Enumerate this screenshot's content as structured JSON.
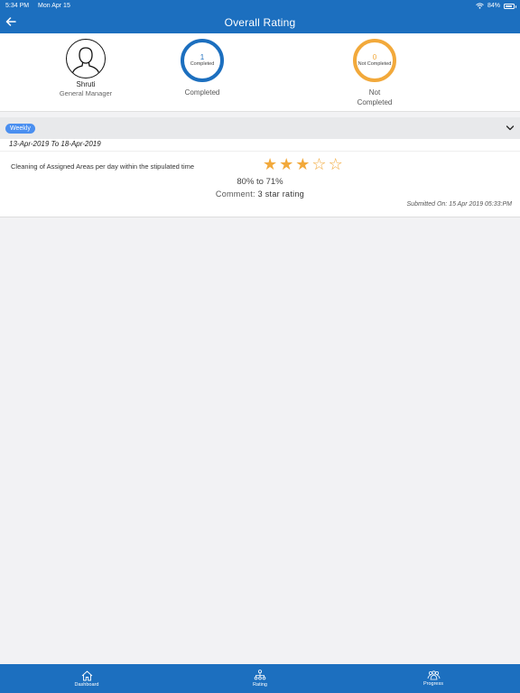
{
  "status_bar": {
    "time": "5:34 PM",
    "date": "Mon Apr 15",
    "battery": "84%",
    "battery_level": 0.84
  },
  "nav": {
    "title": "Overall Rating",
    "back_icon": "arrow-left-icon"
  },
  "profile": {
    "name": "Shruti",
    "role": "General Manager",
    "icon": "user-silhouette-icon"
  },
  "completed": {
    "count": "1",
    "inner_label": "Completed",
    "caption": "Completed",
    "color": "#1c6fbf"
  },
  "not_completed": {
    "count": "0",
    "inner_label": "Not Completed",
    "caption_line1": "Not",
    "caption_line2": "Completed",
    "color": "#f2a93b"
  },
  "rating_card": {
    "badge": "Weekly",
    "date_range": "13-Apr-2019 To 18-Apr-2019",
    "criteria": "Cleaning of Assigned Areas per day within the stipulated time",
    "rating": 3,
    "max_rating": 5,
    "range": "80% to 71%",
    "comment_label": "Comment:",
    "comment_value": "3 star rating",
    "submitted": "Submitted On: 15 Apr 2019 05:33:PM"
  },
  "tabs": [
    {
      "label": "Dashboard",
      "icon": "home-icon"
    },
    {
      "label": "Rating",
      "icon": "hierarchy-icon"
    },
    {
      "label": "Progress",
      "icon": "group-icon"
    }
  ],
  "colors": {
    "primary": "#1c6fbf",
    "accent": "#f2a93b",
    "badge": "#4a8ff0"
  }
}
